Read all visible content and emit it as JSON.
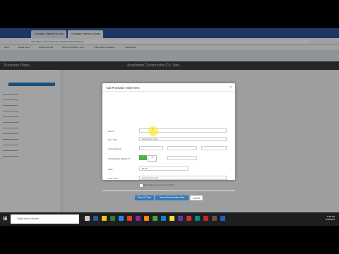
{
  "browser": {
    "tabs": [
      {
        "label": "Contractor Foreman Sub Acc"
      },
      {
        "label": "Contractor Foreman | Constr"
      }
    ],
    "url": "https://app.contractorforeman.net/index.php?module=po",
    "bookmarks": [
      "Apps",
      "Saved items",
      "Getting Started",
      "Submit a Ticket to Con...",
      "PRO Web Contractor...",
      "Dashboard"
    ]
  },
  "app": {
    "left_title": "Purchase Order...",
    "center_title": "Acquisition Construction Co. Sale..."
  },
  "modal": {
    "title": "Add Purchase Order Item",
    "close": "×",
    "fields": {
      "item_label": "Item #",
      "item_value": "1",
      "item_type_label": "Item Type",
      "item_type_value": "Select Item Type",
      "cost_label": "Unit Cost/Unit",
      "markup_label": "Unit Markup/ Markup %",
      "tax_label": "Total",
      "tax_value": "$0.00",
      "cost_code_label": "Cost Code",
      "cost_code_value": "Select Cost Code",
      "checkbox_label": "Save this item to your items list?"
    },
    "buttons": {
      "save_close": "Save & Close",
      "save_add": "Save & Add Another Item",
      "cancel": "Cancel"
    }
  },
  "taskbar": {
    "search_placeholder": "Type here to search",
    "time": "9:45 AM",
    "date": "12/3/2019"
  }
}
